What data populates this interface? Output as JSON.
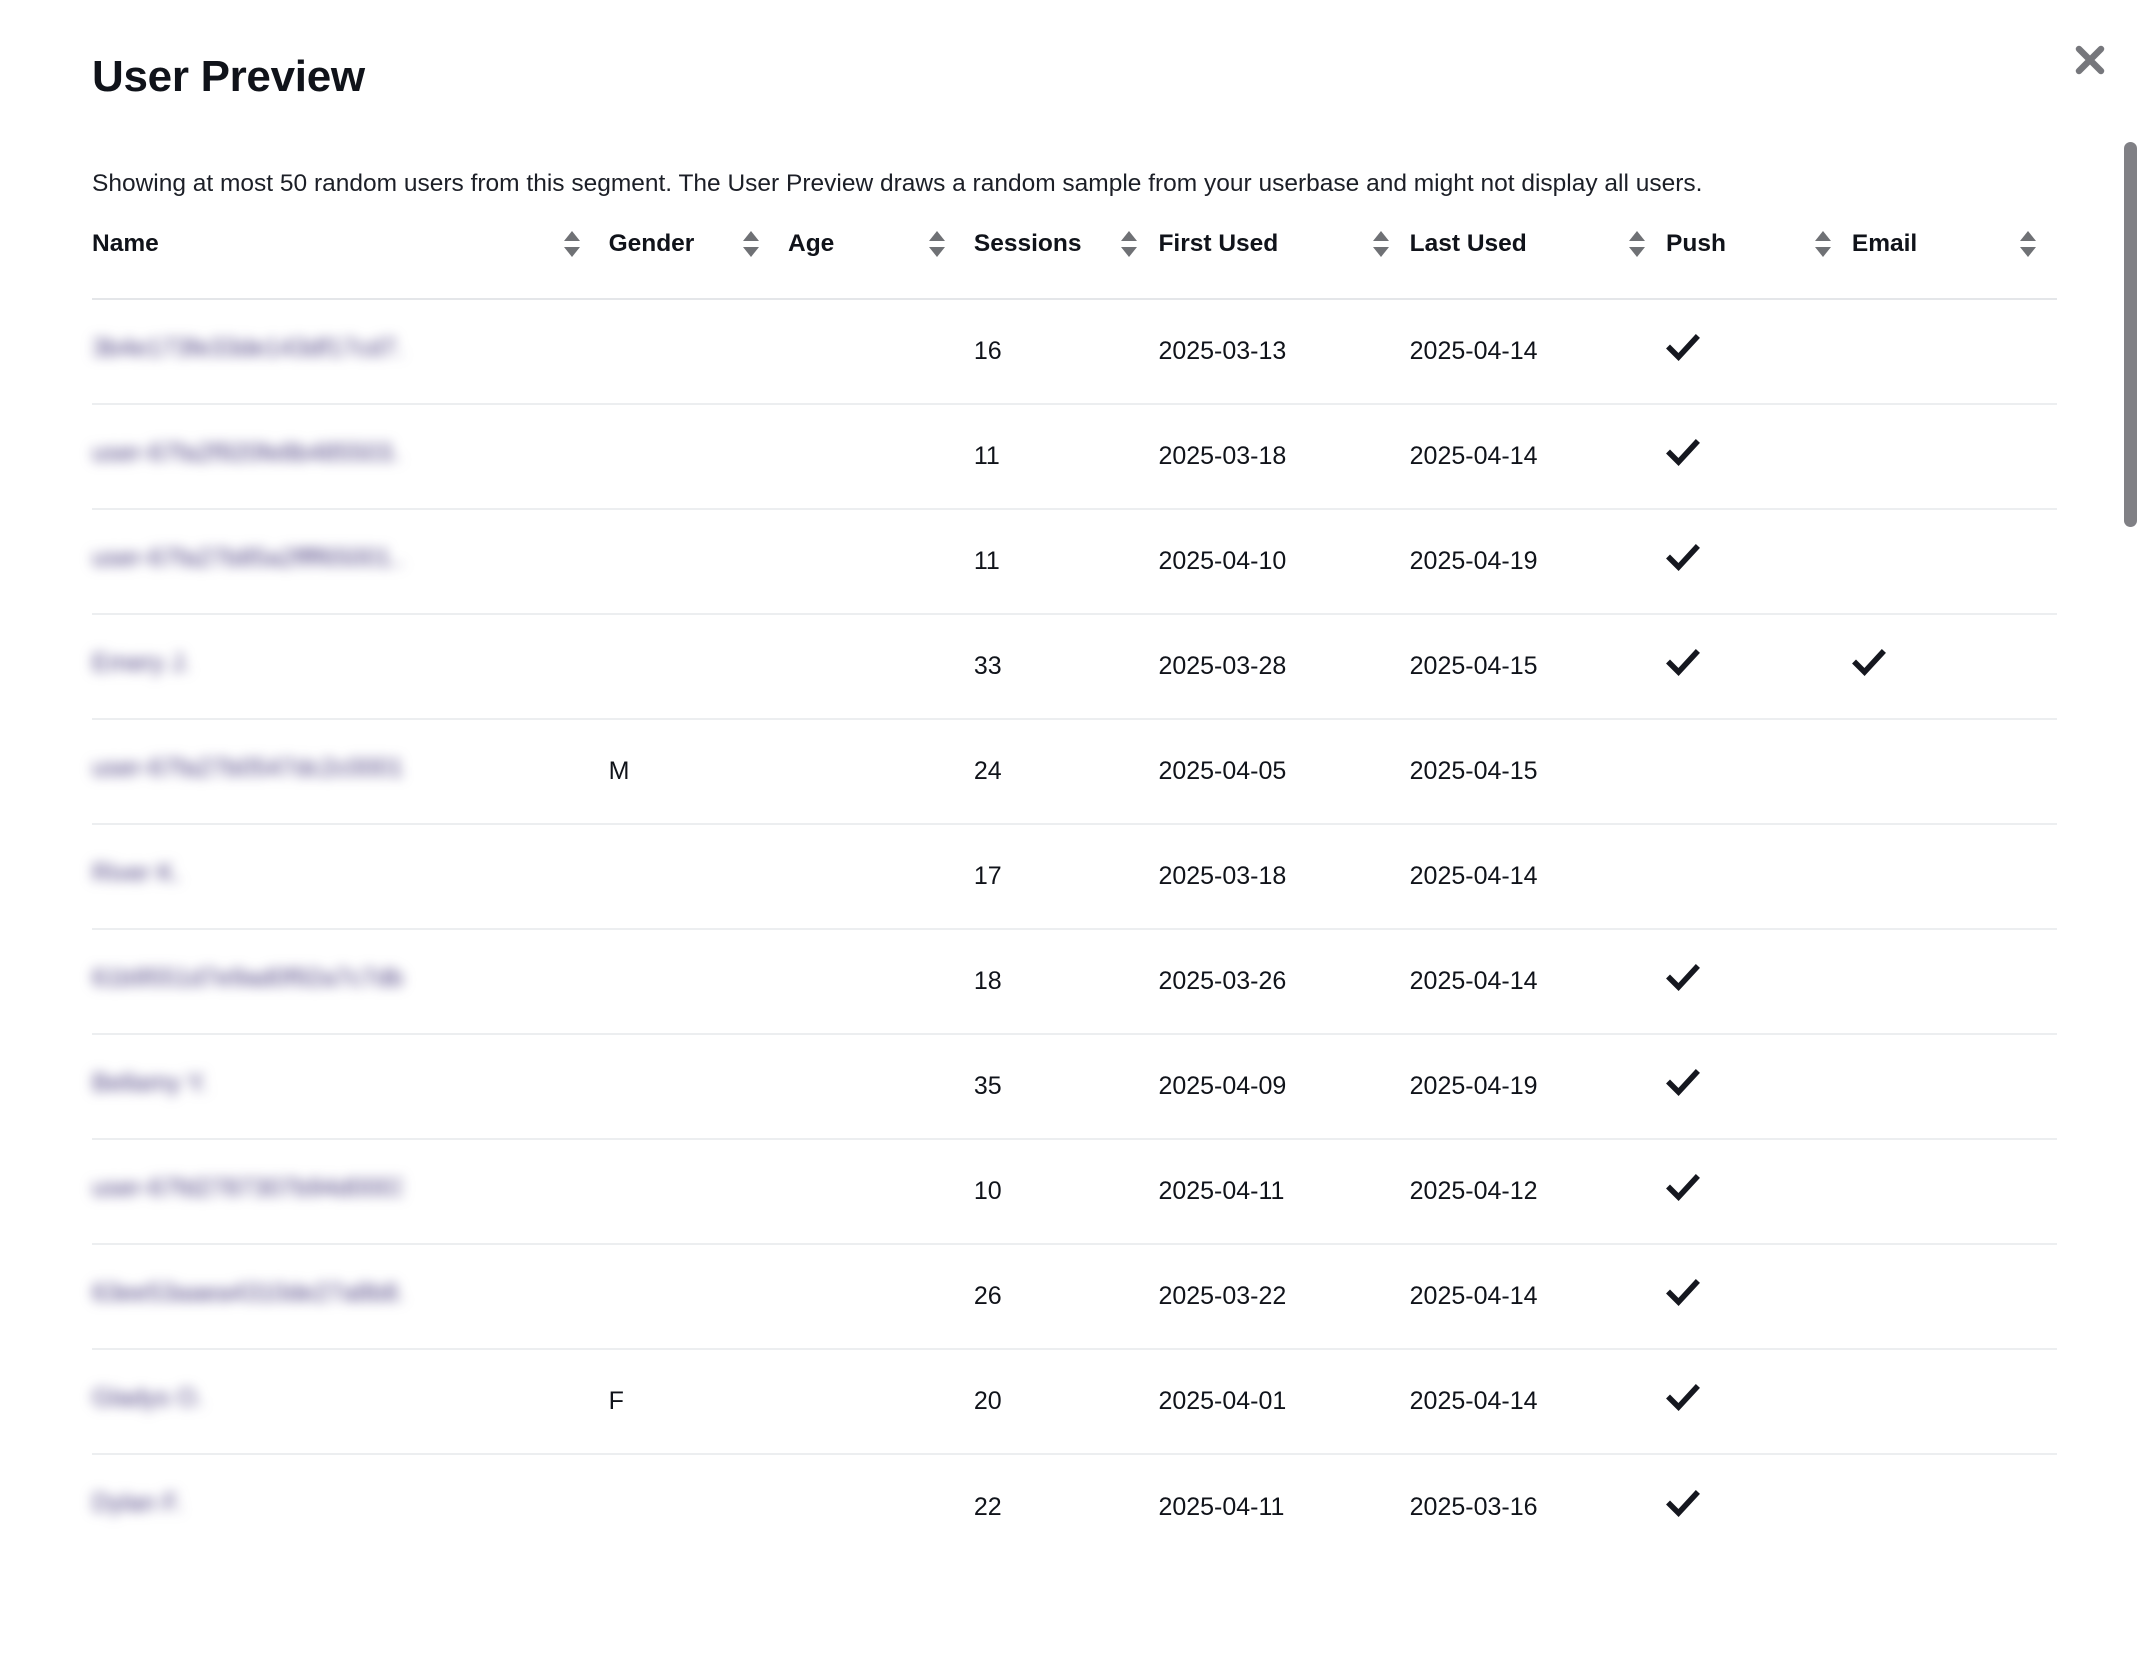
{
  "modal": {
    "title": "User Preview",
    "subtitle": "Showing at most 50 random users from this segment. The User Preview draws a random sample from your userbase and might not display all users.",
    "close_label": "×",
    "close_icon": "close-icon"
  },
  "table": {
    "columns": [
      {
        "label": "Name",
        "key": "name",
        "sort_icon": "sort-icon"
      },
      {
        "label": "Gender",
        "key": "gender",
        "sort_icon": "sort-icon"
      },
      {
        "label": "Age",
        "key": "age",
        "sort_icon": "sort-icon"
      },
      {
        "label": "Sessions",
        "key": "sessions",
        "sort_icon": "sort-icon"
      },
      {
        "label": "First Used",
        "key": "first",
        "sort_icon": "sort-icon"
      },
      {
        "label": "Last Used",
        "key": "last",
        "sort_icon": "sort-icon"
      },
      {
        "label": "Push",
        "key": "push",
        "sort_icon": "sort-icon"
      },
      {
        "label": "Email",
        "key": "email",
        "sort_icon": "sort-icon"
      }
    ],
    "rows": [
      {
        "name": "3b4e173fe33de143df17cd7...",
        "gender": "",
        "age": "",
        "sessions": "16",
        "first": "2025-03-13",
        "last": "2025-04-14",
        "push": true,
        "email": false
      },
      {
        "name": "user-67fa2f920fe8b485503...",
        "gender": "",
        "age": "",
        "sessions": "11",
        "first": "2025-03-18",
        "last": "2025-04-14",
        "push": true,
        "email": false
      },
      {
        "name": "user-67fa27b85a2ffff65001...",
        "gender": "",
        "age": "",
        "sessions": "11",
        "first": "2025-04-10",
        "last": "2025-04-19",
        "push": true,
        "email": false
      },
      {
        "name": "Emery J.",
        "gender": "",
        "age": "",
        "sessions": "33",
        "first": "2025-03-28",
        "last": "2025-04-15",
        "push": true,
        "email": true
      },
      {
        "name": "user-67fa27b0547dc2c0001...",
        "gender": "M",
        "age": "",
        "sessions": "24",
        "first": "2025-04-05",
        "last": "2025-04-15",
        "push": false,
        "email": false
      },
      {
        "name": "River K.",
        "gender": "",
        "age": "",
        "sessions": "17",
        "first": "2025-03-18",
        "last": "2025-04-14",
        "push": false,
        "email": false
      },
      {
        "name": "61b9551d7e9ad0f92a7c7db...",
        "gender": "",
        "age": "",
        "sessions": "18",
        "first": "2025-03-26",
        "last": "2025-04-14",
        "push": true,
        "email": false
      },
      {
        "name": "Bellamy Y.",
        "gender": "",
        "age": "",
        "sessions": "35",
        "first": "2025-04-09",
        "last": "2025-04-19",
        "push": true,
        "email": false
      },
      {
        "name": "user-67fd2787307b94d0003...",
        "gender": "",
        "age": "",
        "sessions": "10",
        "first": "2025-04-11",
        "last": "2025-04-12",
        "push": true,
        "email": false
      },
      {
        "name": "63ee53aaea4310de27a8b8...",
        "gender": "",
        "age": "",
        "sessions": "26",
        "first": "2025-03-22",
        "last": "2025-04-14",
        "push": true,
        "email": false
      },
      {
        "name": "Gladys O.",
        "gender": "F",
        "age": "",
        "sessions": "20",
        "first": "2025-04-01",
        "last": "2025-04-14",
        "push": true,
        "email": false
      },
      {
        "name": "Dylan F.",
        "gender": "",
        "age": "",
        "sessions": "22",
        "first": "2025-04-11",
        "last": "2025-03-16",
        "push": true,
        "email": false
      }
    ]
  },
  "colors": {
    "text": "#10131a",
    "muted": "#6f7175",
    "name_link": "#4b3f80",
    "row_border": "#eceef0",
    "scrollbar": "#808085"
  },
  "scrollbar": {
    "name": "vertical-scrollbar"
  }
}
